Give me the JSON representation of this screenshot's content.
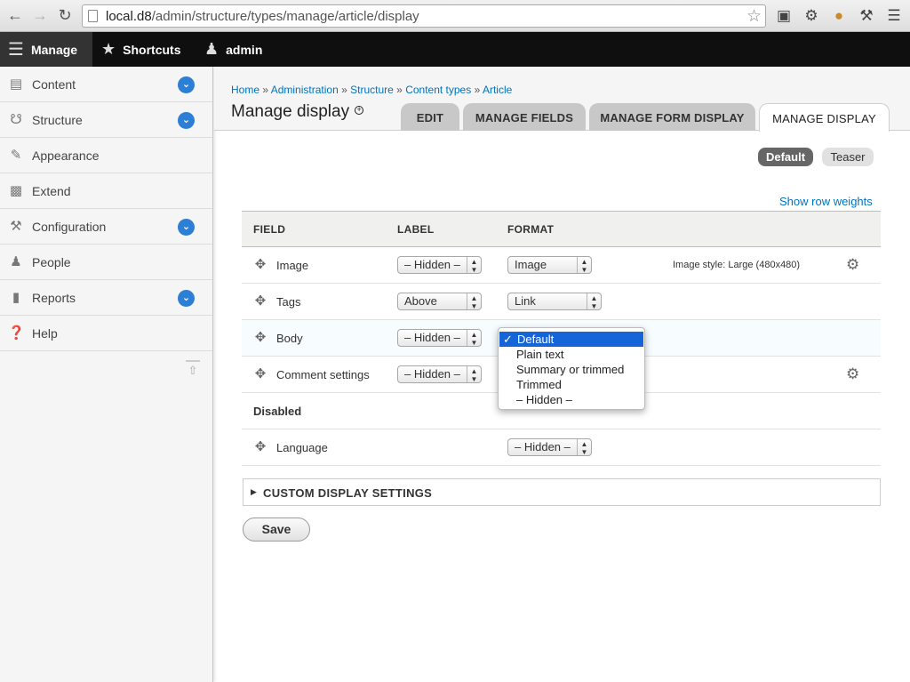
{
  "browser": {
    "url_host": "local.d8",
    "url_path": "/admin/structure/types/manage/article/display"
  },
  "toolbar": {
    "manage": "Manage",
    "shortcuts": "Shortcuts",
    "user": "admin"
  },
  "sidebar": {
    "items": [
      {
        "label": "Content"
      },
      {
        "label": "Structure"
      },
      {
        "label": "Appearance"
      },
      {
        "label": "Extend"
      },
      {
        "label": "Configuration"
      },
      {
        "label": "People"
      },
      {
        "label": "Reports"
      },
      {
        "label": "Help"
      }
    ]
  },
  "breadcrumb": {
    "items": [
      "Home",
      "Administration",
      "Structure",
      "Content types",
      "Article"
    ],
    "separator": "»"
  },
  "page_title": "Manage display",
  "tabs": [
    "EDIT",
    "MANAGE FIELDS",
    "MANAGE FORM DISPLAY",
    "MANAGE DISPLAY"
  ],
  "view_modes": [
    "Default",
    "Teaser"
  ],
  "row_weights_link": "Show row weights",
  "table": {
    "headers": [
      "FIELD",
      "LABEL",
      "FORMAT"
    ],
    "rows": [
      {
        "field": "Image",
        "label": "– Hidden –",
        "format": "Image",
        "summary": "Image style: Large (480x480)"
      },
      {
        "field": "Tags",
        "label": "Above",
        "format": "Link"
      },
      {
        "field": "Body",
        "label": "– Hidden –"
      },
      {
        "field": "Comment settings",
        "label": "– Hidden –"
      }
    ],
    "disabled_region": "Disabled",
    "disabled_rows": [
      {
        "field": "Language",
        "format": "– Hidden –"
      }
    ]
  },
  "format_dropdown": {
    "check": "✓",
    "options": [
      "Default",
      "Plain text",
      "Summary or trimmed",
      "Trimmed",
      "– Hidden –"
    ],
    "selected": "Default"
  },
  "custom_display_settings": "CUSTOM DISPLAY SETTINGS",
  "save_button": "Save",
  "colors": {
    "link": "#0074bd",
    "toolbar_bg": "#0f0f0f",
    "chevron_badge": "#2d7ed5",
    "dropdown_highlight": "#1665d8"
  }
}
